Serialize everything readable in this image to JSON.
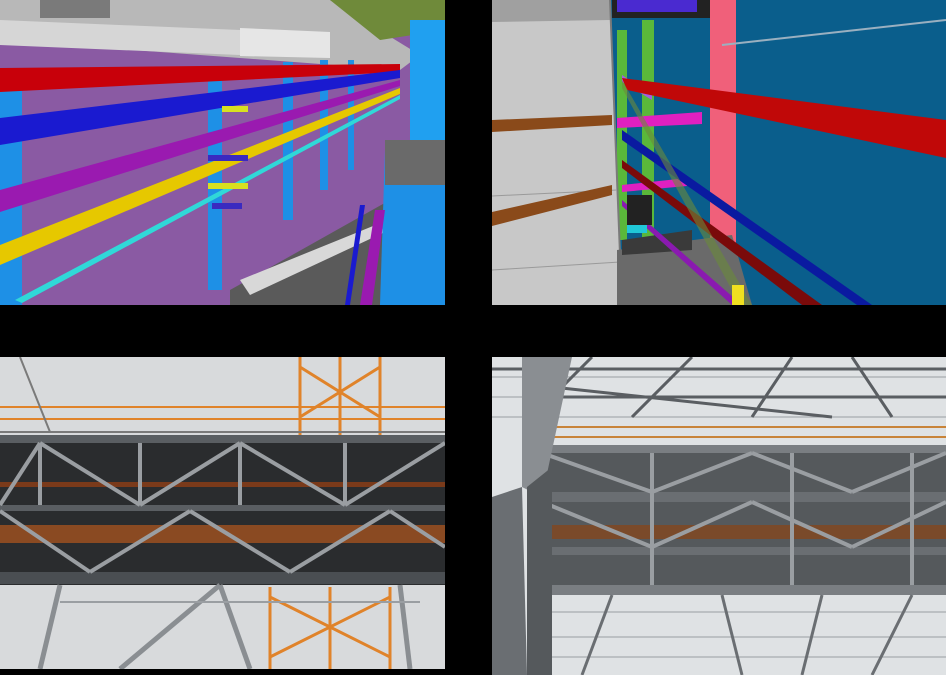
{
  "grid": {
    "background": "#000000",
    "panels": [
      {
        "kind": "bim-render",
        "palette": [
          "#8a5aa3",
          "#c8000a",
          "#1a1ad0",
          "#e6c800",
          "#1e90e6",
          "#30d8d8",
          "#9a1ab0"
        ]
      },
      {
        "kind": "bim-render",
        "palette": [
          "#0a5e8c",
          "#f0607a",
          "#c00808",
          "#0a1aa0",
          "#d0d0d0",
          "#8a4a1a",
          "#e020c0"
        ]
      },
      {
        "kind": "photo",
        "palette": [
          "#d8dadc",
          "#2a2c2e",
          "#e0832a",
          "#9a9ea2"
        ]
      },
      {
        "kind": "photo",
        "palette": [
          "#dfe2e4",
          "#55595c",
          "#c8843a",
          "#8a8f93"
        ]
      }
    ]
  }
}
